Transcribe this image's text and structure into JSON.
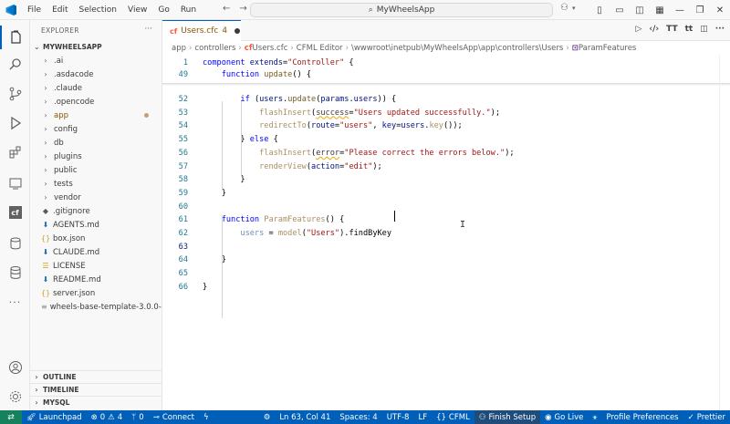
{
  "titlebar": {
    "menus": [
      "File",
      "Edit",
      "Selection",
      "View",
      "Go",
      "Run"
    ],
    "search_text": "MyWheelsApp"
  },
  "sidebar": {
    "header": "EXPLORER",
    "root": "MYWHEELSAPP",
    "items": [
      {
        "label": ".ai",
        "type": "folder"
      },
      {
        "label": ".asdacode",
        "type": "folder"
      },
      {
        "label": ".claude",
        "type": "folder"
      },
      {
        "label": ".opencode",
        "type": "folder"
      },
      {
        "label": "app",
        "type": "folder",
        "modified": true
      },
      {
        "label": "config",
        "type": "folder"
      },
      {
        "label": "db",
        "type": "folder"
      },
      {
        "label": "plugins",
        "type": "folder"
      },
      {
        "label": "public",
        "type": "folder"
      },
      {
        "label": "tests",
        "type": "folder"
      },
      {
        "label": "vendor",
        "type": "folder"
      },
      {
        "label": ".gitignore",
        "type": "file",
        "icon": "diamond",
        "color": "#5a5a5a"
      },
      {
        "label": "AGENTS.md",
        "type": "file",
        "icon": "down-arrow",
        "color": "#1a6fb5"
      },
      {
        "label": "box.json",
        "type": "file",
        "icon": "braces",
        "color": "#c9a227"
      },
      {
        "label": "CLAUDE.md",
        "type": "file",
        "icon": "down-arrow",
        "color": "#1a6fb5"
      },
      {
        "label": "LICENSE",
        "type": "file",
        "icon": "bars",
        "color": "#c9a227"
      },
      {
        "label": "README.md",
        "type": "file",
        "icon": "down-arrow",
        "color": "#1a6fb5"
      },
      {
        "label": "server.json",
        "type": "file",
        "icon": "braces",
        "color": "#c9a227"
      },
      {
        "label": "wheels-base-template-3.0.0-...",
        "type": "file",
        "icon": "lines",
        "color": "#8a8a8a"
      }
    ],
    "sections": [
      "OUTLINE",
      "TIMELINE",
      "MYSQL"
    ]
  },
  "editor": {
    "tab": {
      "icon_text": "cf",
      "label": "Users.cfc",
      "problems": "4"
    },
    "actions": [
      "‹/›",
      "TT",
      "tt"
    ],
    "breadcrumb": [
      "app",
      "controllers",
      "Users.cfc",
      "CFML Editor",
      "\\wwwroot\\inetpub\\MyWheelsApp\\app\\controllers\\Users",
      "ParamFeatures"
    ],
    "sticky_lines": [
      {
        "num": "1",
        "tokens": [
          [
            "kw",
            "component "
          ],
          [
            "var",
            "extends"
          ],
          [
            "plain",
            "="
          ],
          [
            "str",
            "\"Controller\""
          ],
          [
            "plain",
            " {"
          ]
        ]
      },
      {
        "num": "49",
        "tokens": [
          [
            "plain",
            "    "
          ],
          [
            "kw",
            "function "
          ],
          [
            "fn",
            "update"
          ],
          [
            "plain",
            "() {"
          ]
        ]
      }
    ],
    "lines": [
      {
        "num": "52",
        "tokens": [
          [
            "plain",
            "        "
          ],
          [
            "kw",
            "if "
          ],
          [
            "plain",
            "("
          ],
          [
            "var",
            "users"
          ],
          [
            "plain",
            "."
          ],
          [
            "fn",
            "update"
          ],
          [
            "plain",
            "("
          ],
          [
            "var",
            "params"
          ],
          [
            "plain",
            "."
          ],
          [
            "var",
            "users"
          ],
          [
            "plain",
            ")) {"
          ]
        ]
      },
      {
        "num": "53",
        "tokens": [
          [
            "plain",
            "            "
          ],
          [
            "dimfn",
            "flashInsert"
          ],
          [
            "plain",
            "("
          ],
          [
            "squig",
            "success"
          ],
          [
            "plain",
            "="
          ],
          [
            "str",
            "\"Users updated successfully.\""
          ],
          [
            "plain",
            ");"
          ]
        ]
      },
      {
        "num": "54",
        "tokens": [
          [
            "plain",
            "            "
          ],
          [
            "dimfn",
            "redirectTo"
          ],
          [
            "plain",
            "("
          ],
          [
            "var",
            "route"
          ],
          [
            "plain",
            "="
          ],
          [
            "str",
            "\"users\""
          ],
          [
            "plain",
            ", "
          ],
          [
            "var",
            "key"
          ],
          [
            "plain",
            "="
          ],
          [
            "var",
            "users"
          ],
          [
            "plain",
            "."
          ],
          [
            "dimfn",
            "key"
          ],
          [
            "plain",
            "());"
          ]
        ]
      },
      {
        "num": "55",
        "tokens": [
          [
            "plain",
            "        } "
          ],
          [
            "kw",
            "else "
          ],
          [
            "plain",
            "{"
          ]
        ]
      },
      {
        "num": "56",
        "tokens": [
          [
            "plain",
            "            "
          ],
          [
            "dimfn",
            "flashInsert"
          ],
          [
            "plain",
            "("
          ],
          [
            "squig",
            "error"
          ],
          [
            "plain",
            "="
          ],
          [
            "str",
            "\"Please correct the errors below.\""
          ],
          [
            "plain",
            ");"
          ]
        ]
      },
      {
        "num": "57",
        "tokens": [
          [
            "plain",
            "            "
          ],
          [
            "dimfn",
            "renderView"
          ],
          [
            "plain",
            "("
          ],
          [
            "var",
            "action"
          ],
          [
            "plain",
            "="
          ],
          [
            "str",
            "\"edit\""
          ],
          [
            "plain",
            ");"
          ]
        ]
      },
      {
        "num": "58",
        "tokens": [
          [
            "plain",
            "        }"
          ]
        ]
      },
      {
        "num": "59",
        "tokens": [
          [
            "plain",
            "    }"
          ]
        ]
      },
      {
        "num": "60",
        "tokens": []
      },
      {
        "num": "61",
        "tokens": [
          [
            "plain",
            "    "
          ],
          [
            "kw",
            "function "
          ],
          [
            "dimfn",
            "ParamFeatures"
          ],
          [
            "plain",
            "() {"
          ]
        ]
      },
      {
        "num": "62",
        "tokens": [
          [
            "plain",
            "        "
          ],
          [
            "dimvar",
            "users"
          ],
          [
            "plain",
            " = "
          ],
          [
            "dimfn",
            "model"
          ],
          [
            "plain",
            "("
          ],
          [
            "str",
            "\"Users\""
          ],
          [
            "plain",
            ")."
          ],
          [
            "plain",
            "findByKey"
          ]
        ]
      },
      {
        "num": "63",
        "tokens": []
      },
      {
        "num": "64",
        "tokens": [
          [
            "plain",
            "    }"
          ]
        ]
      },
      {
        "num": "65",
        "tokens": []
      },
      {
        "num": "66",
        "tokens": [
          [
            "plain",
            "}"
          ]
        ]
      }
    ],
    "current_line": "63"
  },
  "statusbar": {
    "launchpad": "Launchpad",
    "errors": "0",
    "warnings": "4",
    "ports": "0",
    "connect": "Connect",
    "position": "Ln 63, Col 41",
    "spaces": "Spaces: 4",
    "encoding": "UTF-8",
    "eol": "LF",
    "language": "CFML",
    "finish_setup": "Finish Setup",
    "go_live": "Go Live",
    "profile": "Profile Preferences",
    "prettier": "Prettier"
  },
  "colors": {
    "accent": "#005fb8",
    "remote": "#16825d"
  }
}
